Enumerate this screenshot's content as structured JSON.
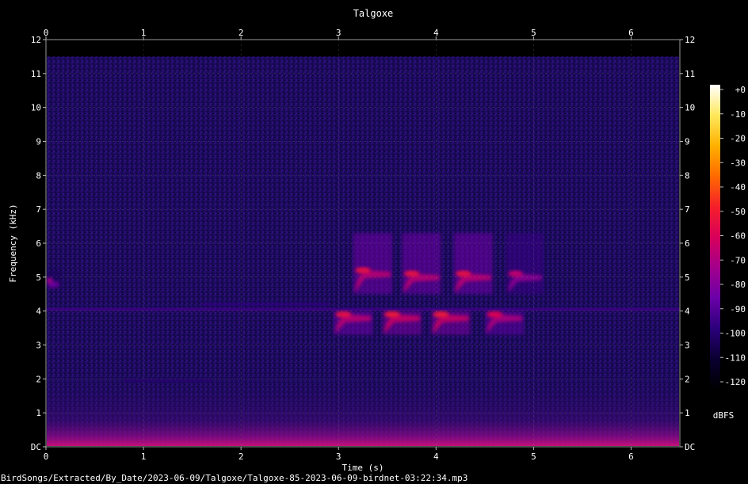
{
  "chart_data": {
    "type": "heatmap",
    "title": "Talgoxe",
    "xlabel": "Time (s)",
    "ylabel": "Frequency (kHz)",
    "xlim": [
      0,
      6.5
    ],
    "ylim": [
      0,
      12
    ],
    "x_ticks": [
      "0",
      "1",
      "2",
      "3",
      "4",
      "5",
      "6"
    ],
    "y_ticks": [
      "DC",
      "1",
      "2",
      "3",
      "4",
      "5",
      "6",
      "7",
      "8",
      "9",
      "10",
      "11",
      "12"
    ],
    "colorbar": {
      "label": "dBFS",
      "range": [
        -120,
        0
      ],
      "ticks": [
        "+0",
        "-10",
        "-20",
        "-30",
        "-40",
        "-50",
        "-60",
        "-70",
        "-80",
        "-90",
        "-100",
        "-110",
        "-120"
      ],
      "colors": [
        "#000000",
        "#0a0030",
        "#2a007a",
        "#6a00a8",
        "#a2008c",
        "#d8005a",
        "#f51f2a",
        "#ff6a00",
        "#ffb000",
        "#ffe85c",
        "#ffffff"
      ]
    },
    "noise_floor_top_khz": 11.5,
    "calls": [
      {
        "t_start": 2.95,
        "t_end": 3.35,
        "f_low": 3.3,
        "f_high": 4.0,
        "peak_khz": 3.9,
        "level_db": -55
      },
      {
        "t_start": 3.15,
        "t_end": 3.55,
        "f_low": 4.5,
        "f_high": 6.3,
        "peak_khz": 5.2,
        "level_db": -55
      },
      {
        "t_start": 3.45,
        "t_end": 3.85,
        "f_low": 3.3,
        "f_high": 4.0,
        "peak_khz": 3.9,
        "level_db": -52
      },
      {
        "t_start": 3.65,
        "t_end": 4.05,
        "f_low": 4.5,
        "f_high": 6.3,
        "peak_khz": 5.1,
        "level_db": -55
      },
      {
        "t_start": 3.95,
        "t_end": 4.35,
        "f_low": 3.3,
        "f_high": 4.0,
        "peak_khz": 3.9,
        "level_db": -52
      },
      {
        "t_start": 4.18,
        "t_end": 4.58,
        "f_low": 4.5,
        "f_high": 6.3,
        "peak_khz": 5.1,
        "level_db": -55
      },
      {
        "t_start": 4.5,
        "t_end": 4.9,
        "f_low": 3.3,
        "f_high": 4.0,
        "peak_khz": 3.9,
        "level_db": -58
      },
      {
        "t_start": 4.72,
        "t_end": 5.1,
        "f_low": 4.5,
        "f_high": 6.3,
        "peak_khz": 5.1,
        "level_db": -65
      },
      {
        "t_start": 0.0,
        "t_end": 0.15,
        "f_low": 4.7,
        "f_high": 5.2,
        "peak_khz": 4.9,
        "level_db": -72
      }
    ],
    "faint_traces": [
      {
        "t_start": 0.0,
        "t_end": 6.5,
        "f_khz": 4.05,
        "level_db": -92
      },
      {
        "t_start": 1.6,
        "t_end": 2.9,
        "f_khz": 4.2,
        "level_db": -95
      },
      {
        "t_start": 0.8,
        "t_end": 1.7,
        "f_khz": 1.95,
        "level_db": -98
      }
    ]
  },
  "footer": {
    "path": "BirdSongs/Extracted/By_Date/2023-06-09/Talgoxe/Talgoxe-85-2023-06-09-birdnet-03:22:34.mp3"
  }
}
